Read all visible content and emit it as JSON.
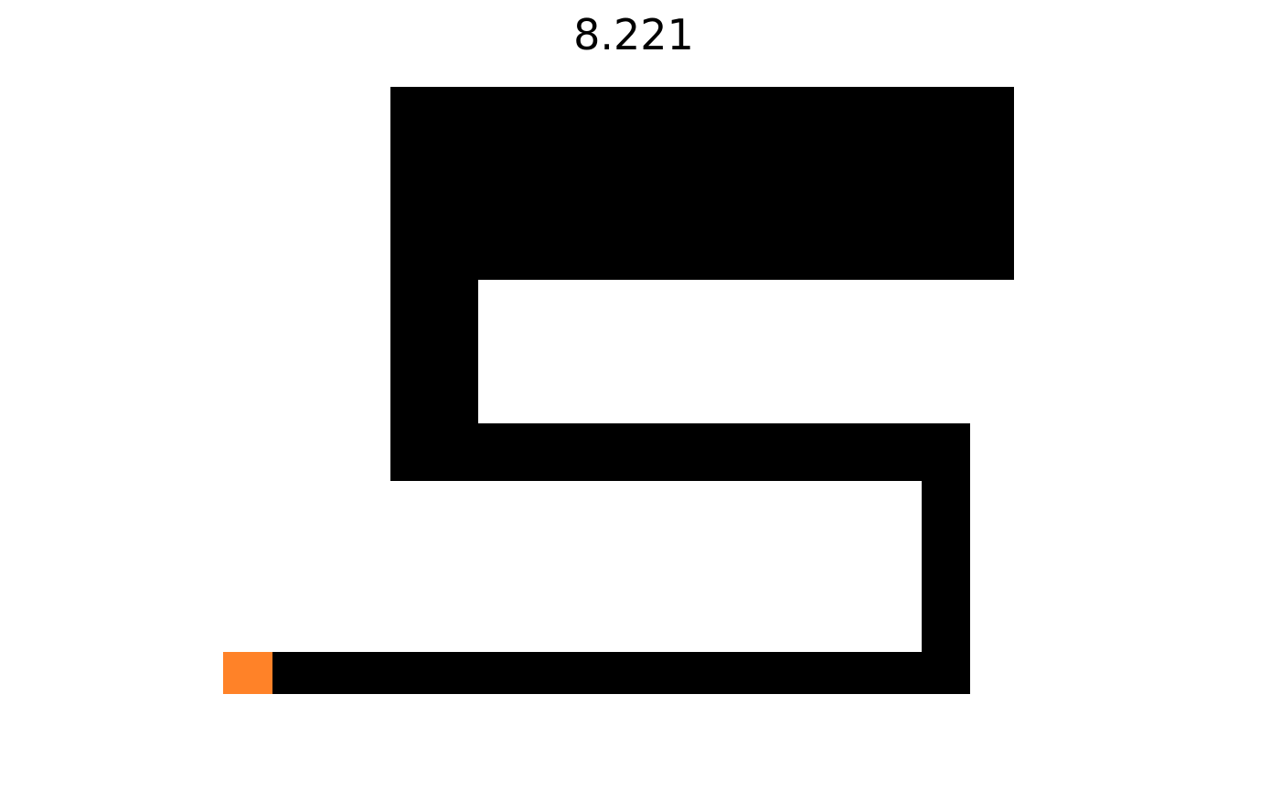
{
  "score": {
    "value": "8.221"
  },
  "colors": {
    "background": "#ffffff",
    "track": "#000000",
    "player": "#ff8228",
    "text": "#000000"
  }
}
